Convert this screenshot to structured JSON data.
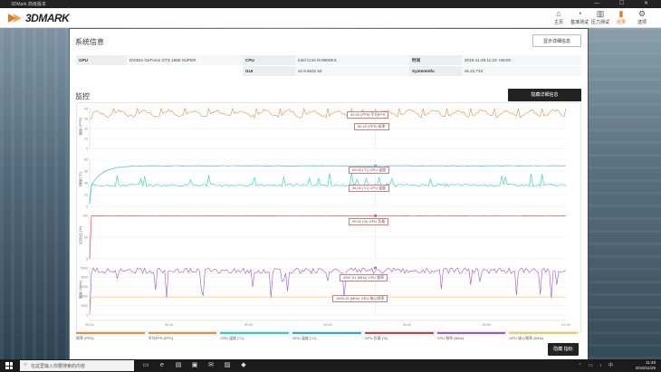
{
  "window": {
    "title": "3DMark 高级版本",
    "controls": "— ☐ ✕"
  },
  "app": {
    "logo_text": "3DMARK"
  },
  "nav": [
    {
      "label": "主页",
      "icon": "home-icon",
      "glyph": "⌂",
      "active": false
    },
    {
      "label": "基准测试",
      "icon": "gauge-icon",
      "glyph": "◔",
      "active": false
    },
    {
      "label": "压力测试",
      "icon": "stress-icon",
      "glyph": "▥",
      "active": false
    },
    {
      "label": "结果",
      "icon": "bar-chart-icon",
      "glyph": "▮",
      "active": true
    },
    {
      "label": "选项",
      "icon": "gear-icon",
      "glyph": "⚙",
      "active": false
    }
  ],
  "system_info": {
    "title": "系统信息",
    "show_details_button": "显示详细信息",
    "rows": [
      [
        {
          "label": "GPU",
          "value": "NVIDIA GeForce GTX 1650 SUPER"
        },
        {
          "label": "CPU",
          "value": "Intel Core i9-9900KS"
        },
        {
          "label": "时间",
          "value": "2019-11-29 11:23 +08:00"
        }
      ],
      [
        {
          "label": "",
          "value": ""
        },
        {
          "label": "GUI",
          "value": "v2.9.6631 64"
        },
        {
          "label": "SystemInfo",
          "value": "v5.22.743"
        }
      ]
    ]
  },
  "monitoring": {
    "title": "监控",
    "hide_details_button": "隐藏详细信息",
    "hide_markers_button": "隐藏 指标",
    "y_labels": [
      "帧率 (FPS)",
      "温度 (°C)",
      "百分比 (%)",
      "频率 (MHz)"
    ],
    "time_ticks": [
      "00:00",
      "00:10",
      "00:20",
      "00:30",
      "00:40",
      "00:50",
      "01:00"
    ],
    "callouts": {
      "fps_a": "30.00 (FPS) 平均FPS",
      "fps_b": "30.42 (FPS) 帧率",
      "temp_a": "69.00 (°C) GPU 温度",
      "temp_b": "36.00 (°C) CPU 温度",
      "load": "99.00 (%) GPU 负载",
      "clk_a": "4997.01 (MHz) CPU 频率",
      "clk_b": "1905.25 (MHz) GPU 核心频率"
    }
  },
  "chart_data": {
    "type": "line",
    "x_unit": "time (mm:ss)",
    "x_range": [
      "00:00",
      "01:00"
    ],
    "panels": [
      {
        "name": "帧率 (FPS)",
        "ylim": [
          0,
          40
        ],
        "yticks": [
          0,
          10,
          20,
          30,
          40
        ],
        "series": [
          {
            "name": "帧率 (FPS)",
            "color": "#ef8a3a",
            "approx_range": [
              30,
              40
            ]
          }
        ]
      },
      {
        "name": "温度 (°C)",
        "ylim": [
          0,
          80
        ],
        "yticks": [
          0,
          20,
          40,
          60,
          80
        ],
        "series": [
          {
            "name": "GPU 温度 (°C)",
            "color": "#29a9d8",
            "approx_value": 69
          },
          {
            "name": "CPU 温度 (°C)",
            "color": "#1fd6b8",
            "approx_value": 36
          }
        ]
      },
      {
        "name": "百分比 (%)",
        "ylim": [
          0,
          100
        ],
        "yticks": [
          0,
          50,
          100
        ],
        "series": [
          {
            "name": "GPU 负载 (%)",
            "color": "#d63a3a",
            "approx_value": 99
          }
        ]
      },
      {
        "name": "频率 (MHz)",
        "ylim": [
          0,
          5000
        ],
        "yticks": [
          0,
          1000,
          2000,
          3000,
          4000,
          5000
        ],
        "series": [
          {
            "name": "CPU 频率 (MHz)",
            "color": "#9b55d6",
            "approx_value": 4997
          },
          {
            "name": "GPU 核心频率 (MHz)",
            "color": "#f3c85e",
            "approx_value": 1905
          }
        ]
      }
    ]
  },
  "legend": [
    {
      "label": "帧率 (FPS)",
      "color": "#ef8a3a"
    },
    {
      "label": "平均FPS (FPS)",
      "color": "#ef8a3a"
    },
    {
      "label": "CPU 温度 (°C)",
      "color": "#1fd6b8"
    },
    {
      "label": "GPU 温度 (°C)",
      "color": "#29a9d8"
    },
    {
      "label": "GPU 负载 (%)",
      "color": "#d63a3a"
    },
    {
      "label": "CPU 频率 (MHz)",
      "color": "#9b55d6"
    },
    {
      "label": "GPU 核心频率 (MHz)",
      "color": "#f3c85e"
    }
  ],
  "taskbar": {
    "search_placeholder": "在这里输入你要搜索的内容",
    "time": "11:48",
    "date": "2019/11/29",
    "pinned": [
      {
        "icon": "task-view-icon",
        "glyph": "▭"
      },
      {
        "icon": "edge-icon",
        "glyph": "e"
      },
      {
        "icon": "file-explorer-icon",
        "glyph": "▤"
      },
      {
        "icon": "store-icon",
        "glyph": "▣"
      },
      {
        "icon": "mail-icon",
        "glyph": "✉"
      },
      {
        "icon": "photos-icon",
        "glyph": "▨"
      },
      {
        "icon": "3dmark-icon",
        "glyph": "◆"
      }
    ]
  }
}
